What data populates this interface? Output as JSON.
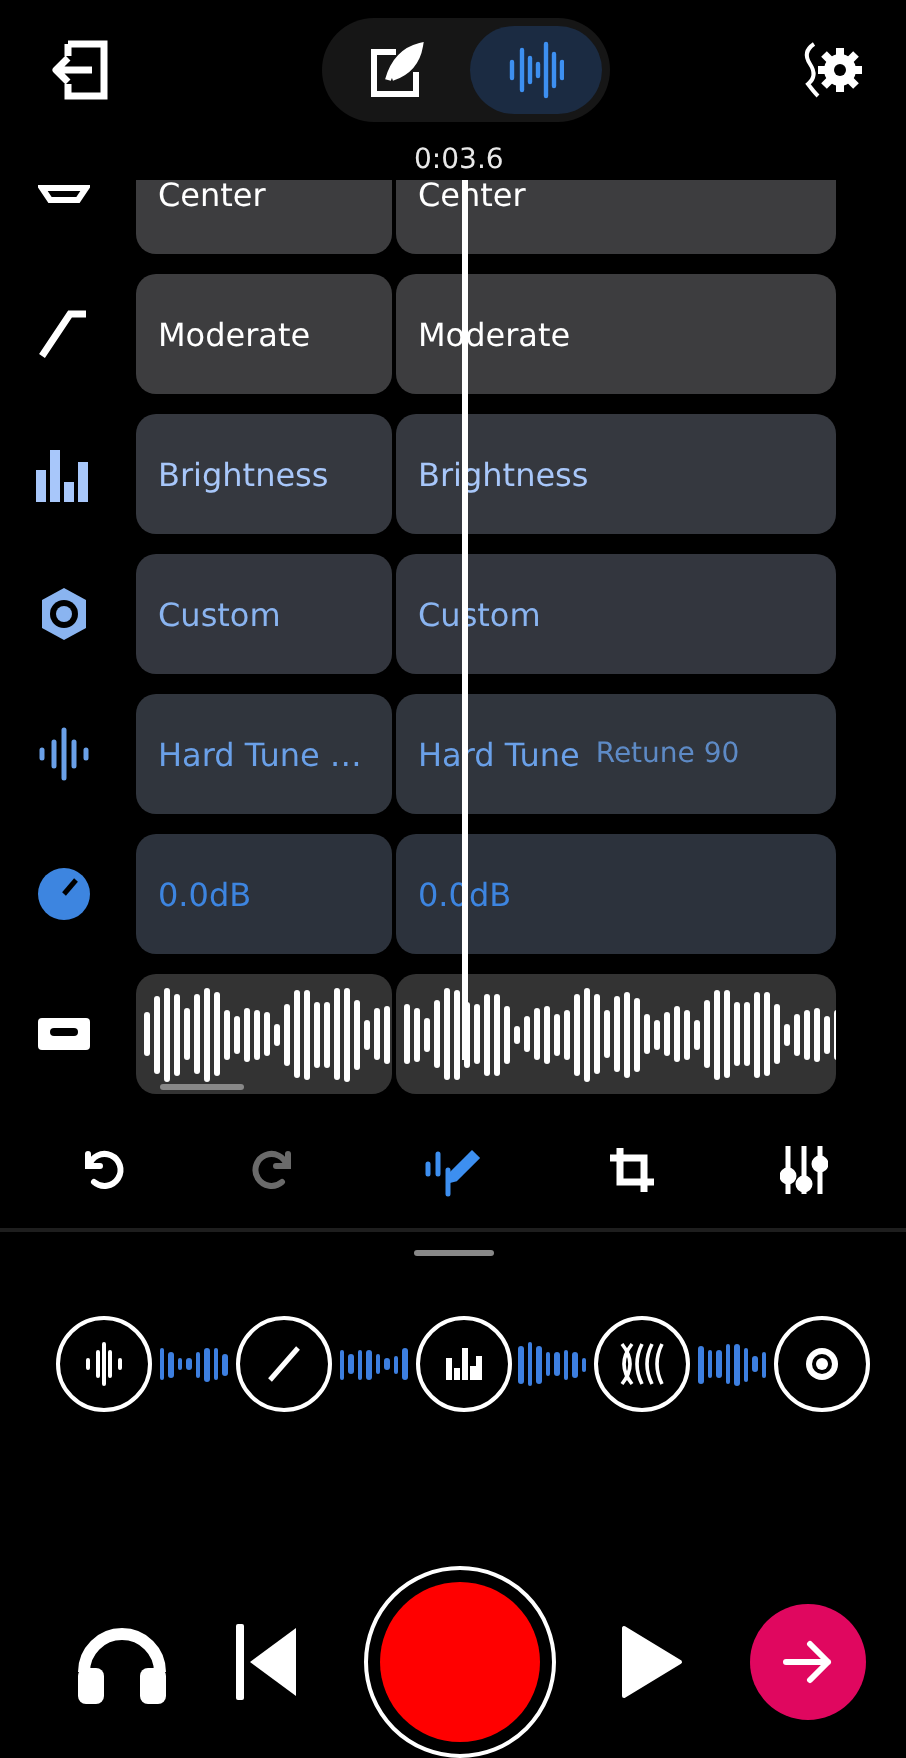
{
  "top_bar": {
    "modes": [
      {
        "kind": "edit",
        "selected": false
      },
      {
        "kind": "waveform",
        "selected": true
      }
    ]
  },
  "playhead": {
    "time": "0:03.6"
  },
  "tracks": [
    {
      "kind": "effect",
      "color": "#ffffff",
      "cells": [
        {
          "label": "Center"
        },
        {
          "label": "Center"
        }
      ]
    },
    {
      "kind": "effect",
      "color": "#ffffff",
      "cells": [
        {
          "label": "Moderate"
        },
        {
          "label": "Moderate"
        }
      ]
    },
    {
      "kind": "effect",
      "color": "#a8c7fa",
      "cells": [
        {
          "label": "Brightness"
        },
        {
          "label": "Brightness"
        }
      ]
    },
    {
      "kind": "effect",
      "color": "#8ab4f0",
      "cells": [
        {
          "label": "Custom"
        },
        {
          "label": "Custom"
        }
      ]
    },
    {
      "kind": "effect",
      "color": "#6aa0e8",
      "cells": [
        {
          "label": "Hard Tune …"
        },
        {
          "label": "Hard Tune",
          "detail": "Retune 90"
        }
      ]
    },
    {
      "kind": "effect",
      "color": "#3d85e0",
      "cells": [
        {
          "label": "0.0dB"
        },
        {
          "label": "0.0dB"
        }
      ]
    },
    {
      "kind": "waveform"
    }
  ],
  "toolbar": [
    {
      "kind": "undo",
      "disabled": false,
      "selected": false
    },
    {
      "kind": "redo",
      "disabled": true,
      "selected": false
    },
    {
      "kind": "edit",
      "disabled": false,
      "selected": true
    },
    {
      "kind": "crop",
      "disabled": false,
      "selected": false
    },
    {
      "kind": "mixer",
      "disabled": false,
      "selected": false
    }
  ],
  "effect_chain": [
    {
      "kind": "pitch"
    },
    {
      "kind": "slope"
    },
    {
      "kind": "bars"
    },
    {
      "kind": "reverb"
    },
    {
      "kind": "target"
    }
  ],
  "transport": [
    {
      "kind": "headphones"
    },
    {
      "kind": "skip"
    },
    {
      "kind": "record"
    },
    {
      "kind": "play"
    },
    {
      "kind": "next"
    }
  ]
}
